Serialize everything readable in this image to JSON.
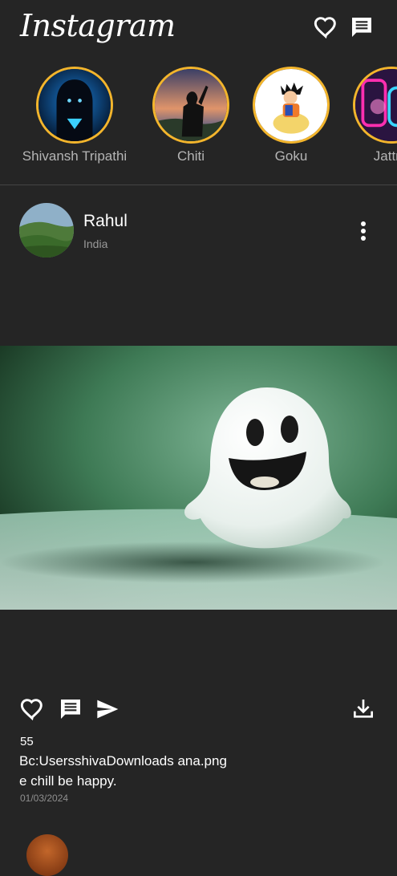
{
  "app": {
    "title": "Instagram"
  },
  "header": {
    "icons": [
      "heart-outline-icon",
      "message-icon"
    ]
  },
  "stories": [
    {
      "name": "Shivansh Tripathi"
    },
    {
      "name": "Chiti"
    },
    {
      "name": "Goku"
    },
    {
      "name": "Jattnii"
    }
  ],
  "post": {
    "username": "Rahul",
    "location": "India",
    "likes": "55",
    "caption": "Bc:UsersshivaDownloads ana.pnge chill be happy.",
    "date": "01/03/2024",
    "actions": [
      "heart-outline-icon",
      "comment-icon",
      "send-icon",
      "download-icon"
    ]
  },
  "colors": {
    "background": "#252525",
    "story_ring": "#f3b52c",
    "secondary_text": "#b5b5b5"
  }
}
